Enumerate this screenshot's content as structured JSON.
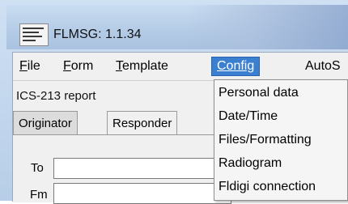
{
  "window": {
    "title": "FLMSG: 1.1.34",
    "icon": "app-icon"
  },
  "menubar": {
    "items": [
      {
        "label": "File",
        "u": "F",
        "rest": "ile"
      },
      {
        "label": "Form",
        "u": "F",
        "rest": "orm"
      },
      {
        "label": "Template",
        "u": "T",
        "rest": "emplate"
      },
      {
        "label": "Config"
      },
      {
        "label": "AutoS"
      }
    ]
  },
  "report": {
    "title": "ICS-213 report"
  },
  "tabs": [
    {
      "label": "Originator"
    },
    {
      "label": "Responder"
    }
  ],
  "form": {
    "to_label": "To",
    "fm_label": "Fm",
    "to_value": "",
    "fm_value": ""
  },
  "config_menu": {
    "items": [
      {
        "label": "Personal data"
      },
      {
        "label": "Date/Time"
      },
      {
        "label": "Files/Formatting"
      },
      {
        "label": "Radiogram"
      },
      {
        "label": "Fldigi connection"
      }
    ]
  },
  "colors": {
    "menu_highlight": "#3a7fd0",
    "title_bar": "#b7cee8"
  }
}
